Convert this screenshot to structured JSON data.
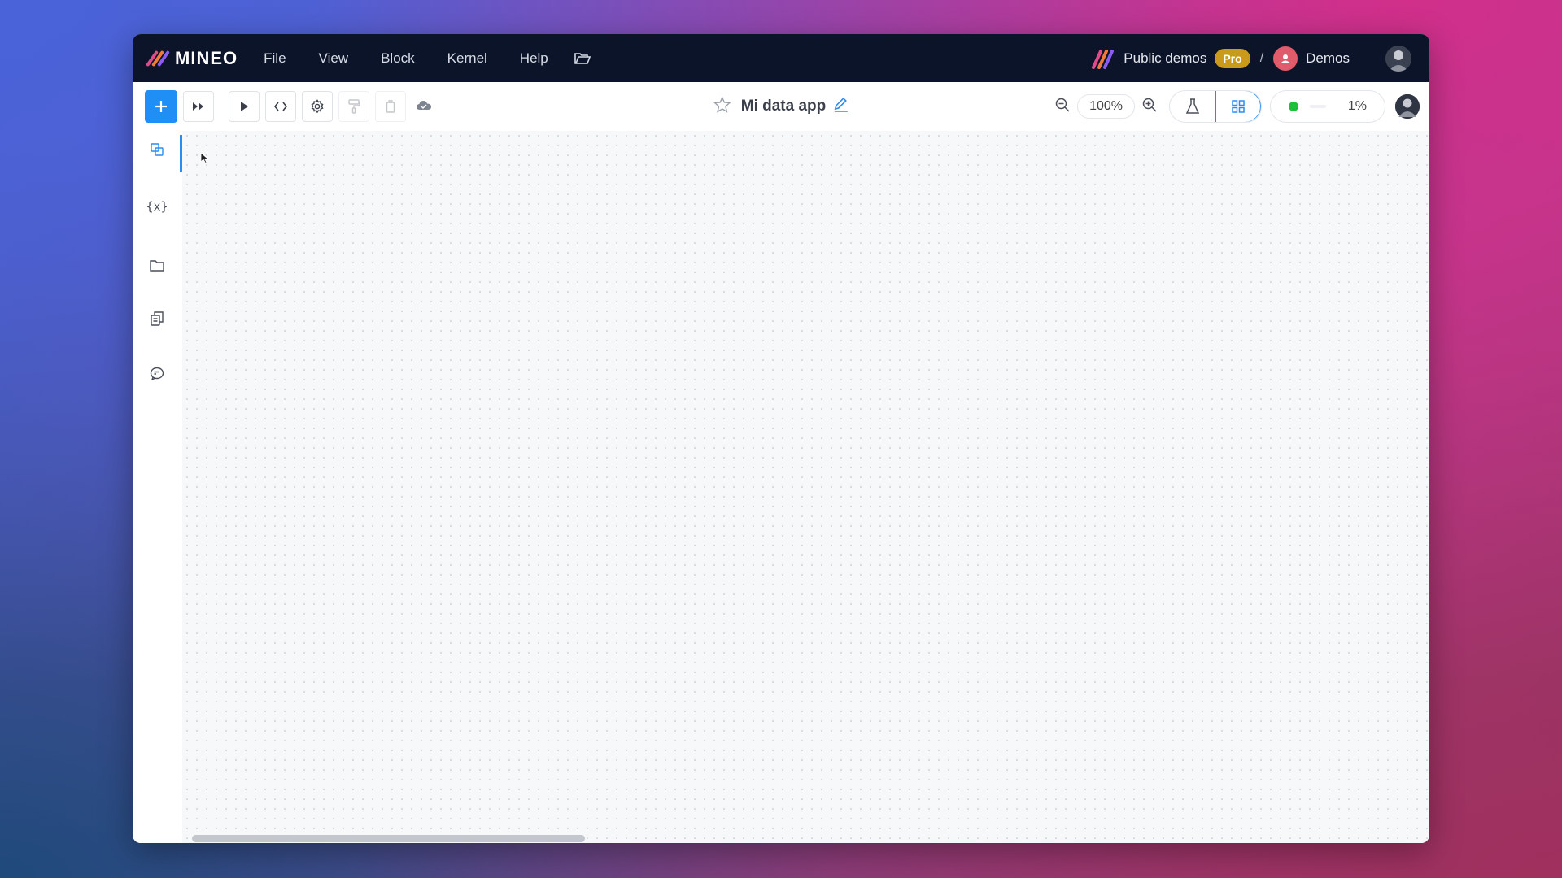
{
  "menubar": {
    "brand": "MINEO",
    "items": [
      "File",
      "View",
      "Block",
      "Kernel",
      "Help"
    ],
    "workspace": "Public demos",
    "plan_badge": "Pro",
    "separator": "/",
    "project": "Demos"
  },
  "toolbar": {
    "app_title": "Mi data app",
    "zoom": "100%",
    "usage_percent": "1%",
    "kernel_status_color": "#1fbf3a"
  },
  "sidebar": {
    "items": [
      "blocks-icon",
      "variables-icon",
      "files-icon",
      "copy-icon",
      "comments-icon"
    ],
    "variables_glyph": "{x}"
  },
  "colors": {
    "accent": "#1f8ff5",
    "menubar_bg": "#0b1428",
    "pro_badge": "#c99a1c"
  }
}
